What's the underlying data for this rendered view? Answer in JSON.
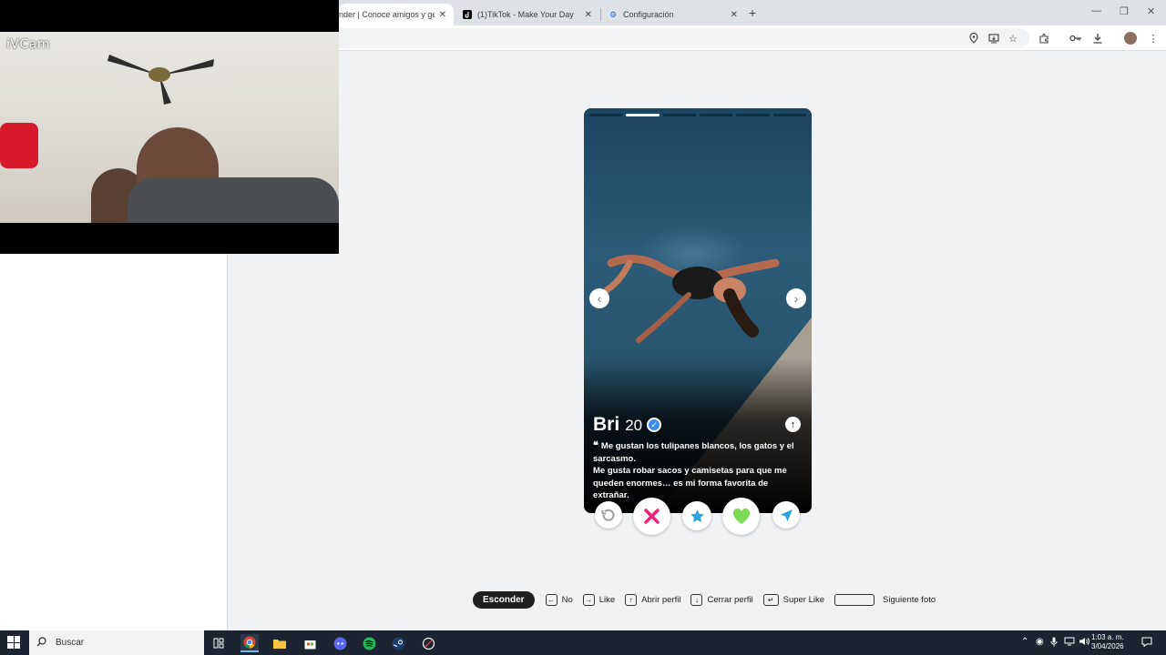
{
  "browser": {
    "tabs": [
      {
        "title": "nder | Conoce amigos y gente",
        "active": true
      },
      {
        "title": "(1)TikTok - Make Your Day",
        "active": false
      },
      {
        "title": "Configuración",
        "active": false
      }
    ],
    "new_tab": "+",
    "close_glyph": "✕",
    "window_controls": {
      "minimize": "—",
      "restore": "❐",
      "close": "✕"
    }
  },
  "webcam": {
    "brand": "iVCam"
  },
  "profile": {
    "name": "Bri",
    "age": "20",
    "photo_count": 6,
    "current_photo": 2,
    "quote_mark": "❝",
    "bio_line1": "Me gustan los tulipanes blancos, los gatos y el sarcasmo.",
    "bio_line2": "Me gusta robar sacos y camisetas para que me queden enormes… es mi forma favorita de extrañar."
  },
  "actions": [
    {
      "name": "rewind",
      "icon": "rewind-icon",
      "color": "#9e9e9e"
    },
    {
      "name": "nope",
      "icon": "close-icon",
      "color": "#e5267a"
    },
    {
      "name": "super-like",
      "icon": "star-icon",
      "color": "#2aa3e0"
    },
    {
      "name": "like",
      "icon": "heart-icon",
      "color": "#7ed957"
    },
    {
      "name": "boost",
      "icon": "send-icon",
      "color": "#2aa3e0"
    }
  ],
  "shortcuts": {
    "hide": "Esconder",
    "no": "No",
    "like": "Like",
    "open_profile": "Abrir perfil",
    "close_profile": "Cerrar perfil",
    "super_like": "Super Like",
    "next_photo": "Siguiente foto"
  },
  "taskbar": {
    "search": "Buscar",
    "time": "1:03 a. m.",
    "date": "3/04/2026"
  }
}
